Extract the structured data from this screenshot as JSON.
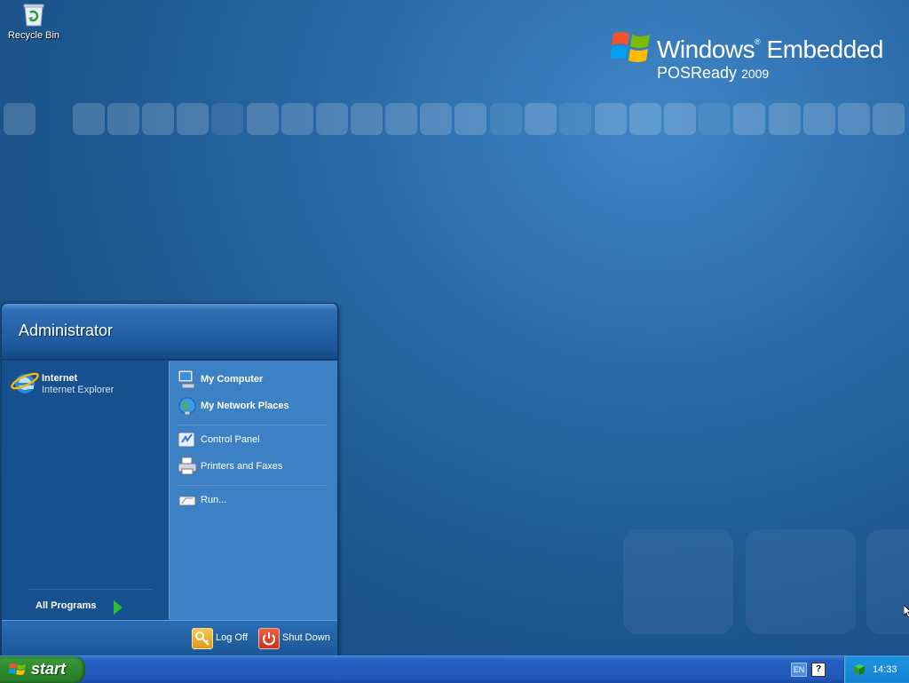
{
  "desktop": {
    "icons": [
      {
        "label": "Recycle Bin",
        "icon": "recycle-bin-icon"
      }
    ],
    "branding": {
      "line1": "Windows",
      "line1b": "Embedded",
      "line2": "POSReady",
      "line2b": "2009",
      "logo_icon": "windows-flag-icon"
    }
  },
  "start_menu": {
    "user": "Administrator",
    "pinned": [
      {
        "label": "Internet",
        "sublabel": "Internet Explorer",
        "icon": "internet-explorer-icon"
      }
    ],
    "all_programs": "All Programs",
    "right_items": [
      {
        "label": "My Computer",
        "icon": "my-computer-icon",
        "bold": true
      },
      {
        "label": "My Network Places",
        "icon": "network-places-icon",
        "bold": true
      },
      {
        "label": "Control Panel",
        "icon": "control-panel-icon",
        "bold": false
      },
      {
        "label": "Printers and Faxes",
        "icon": "printer-icon",
        "bold": false
      },
      {
        "label": "Run...",
        "icon": "run-icon",
        "bold": false
      }
    ],
    "footer": {
      "log_off": "Log Off",
      "shut_down": "Shut Down"
    }
  },
  "taskbar": {
    "start_label": "start",
    "language": "EN",
    "help_label": "?",
    "clock": "14:33"
  },
  "colors": {
    "start_green": "#2f8a2f",
    "taskbar_blue": "#2257b8",
    "tray_blue": "#1282d2"
  }
}
